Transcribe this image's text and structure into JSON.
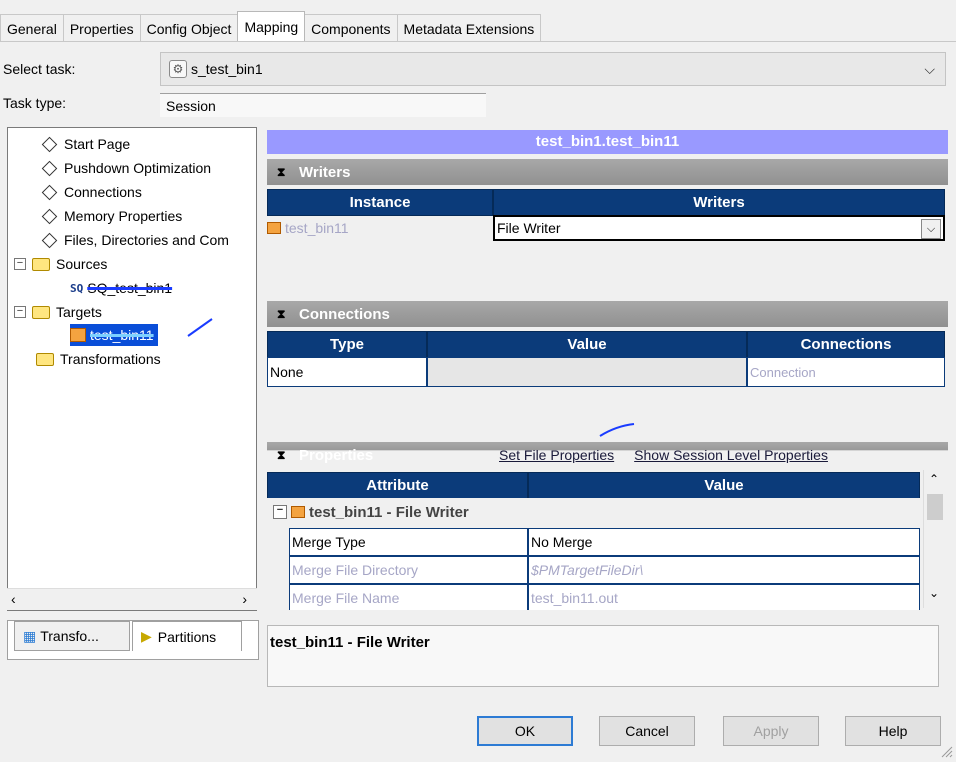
{
  "tabs": [
    "General",
    "Properties",
    "Config Object",
    "Mapping",
    "Components",
    "Metadata Extensions"
  ],
  "active_tab": "Mapping",
  "select_task": {
    "label": "Select task:",
    "value": "s_test_bin1"
  },
  "task_type": {
    "label": "Task type:",
    "value": "Session"
  },
  "tree": {
    "items": [
      "Start Page",
      "Pushdown Optimization",
      "Connections",
      "Memory Properties",
      "Files, Directories and Com"
    ],
    "sources": {
      "label": "Sources",
      "child_prefix": "SQ",
      "child": "SQ_test_bin1"
    },
    "targets": {
      "label": "Targets",
      "child": "test_bin11"
    },
    "transformations": "Transformations"
  },
  "bottom_tabs": [
    "Transfo...",
    "Partitions"
  ],
  "panel_title": "test_bin1.test_bin11",
  "writers": {
    "section": "Writers",
    "headers": [
      "Instance",
      "Writers"
    ],
    "row": {
      "instance": "test_bin11",
      "writer": "File Writer"
    }
  },
  "connections": {
    "section": "Connections",
    "headers": [
      "Type",
      "Value",
      "Connections"
    ],
    "row": {
      "type": "None",
      "value": "",
      "connection": "Connection"
    }
  },
  "properties": {
    "section": "Properties",
    "links": [
      "Set File Properties",
      "Show Session Level Properties"
    ],
    "headers": [
      "Attribute",
      "Value"
    ],
    "group": "test_bin11 - File Writer",
    "rows": [
      {
        "attr": "Merge Type",
        "value": "No Merge"
      },
      {
        "attr": "Merge File Directory",
        "value": "$PMTargetFileDir\\"
      },
      {
        "attr": "Merge File Name",
        "value": "test_bin11.out"
      }
    ]
  },
  "description": "test_bin11 - File Writer",
  "buttons": {
    "ok": "OK",
    "cancel": "Cancel",
    "apply": "Apply",
    "help": "Help"
  },
  "colors": {
    "title_bar": "#9999ff",
    "table_header": "#0b3b7a",
    "ok_border": "#2d7bd4"
  }
}
